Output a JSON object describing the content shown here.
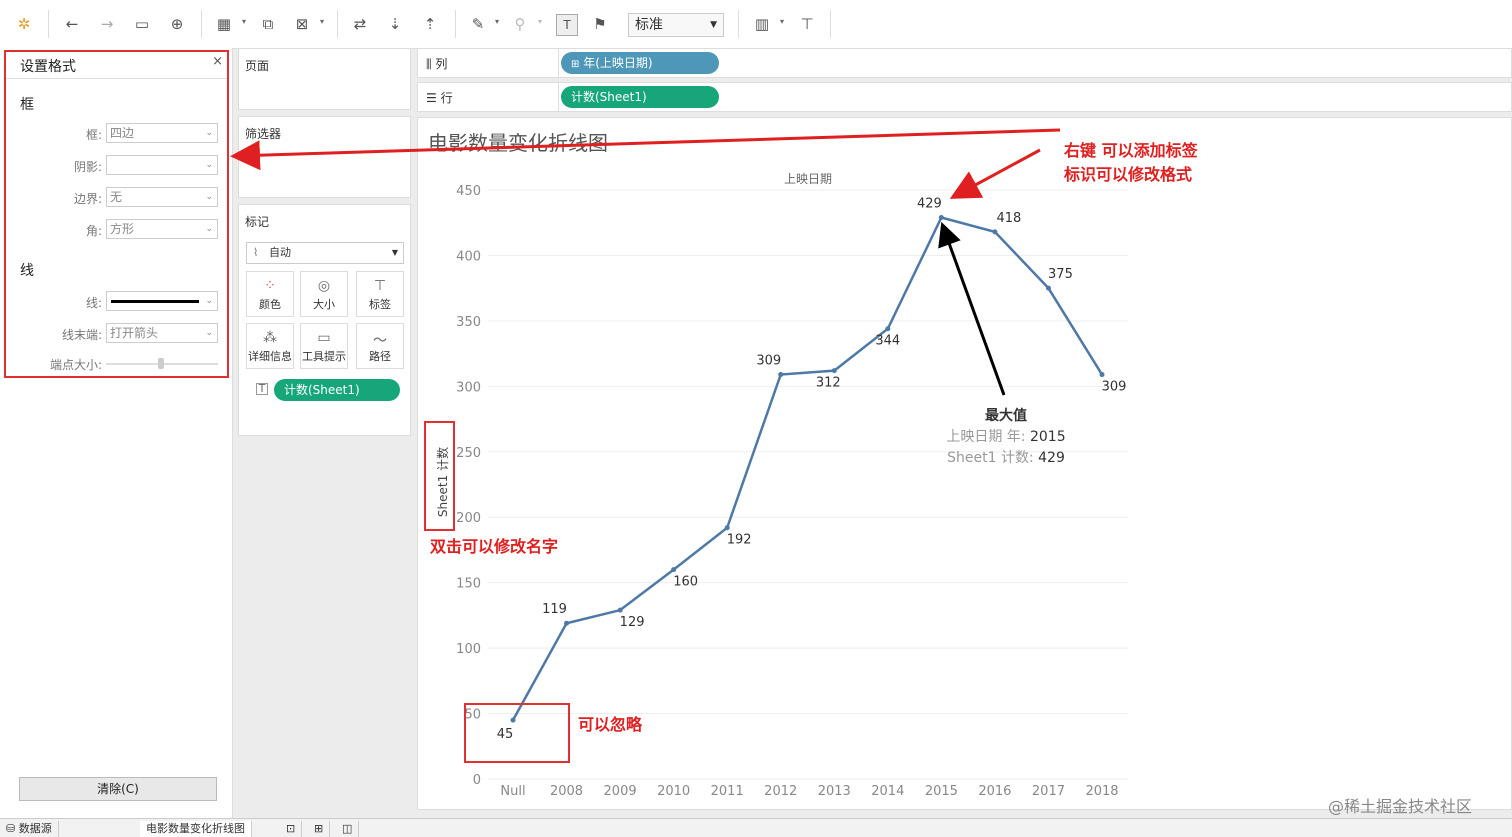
{
  "toolbar": {
    "view_select": "标准",
    "icons": [
      "tableau-logo-icon",
      "undo-icon",
      "redo-icon",
      "save-icon",
      "new-datasource-icon",
      "new-worksheet-icon",
      "duplicate-icon",
      "clear-sheet-icon",
      "swap-icon",
      "sort-asc-icon",
      "sort-desc-icon",
      "highlight-icon",
      "group-icon",
      "label-icon",
      "pin-icon",
      "show-me-icon",
      "presentation-icon"
    ]
  },
  "format_pane": {
    "title": "设置格式",
    "close": "×",
    "section_box": "框",
    "box_label": "框:",
    "box_value": "四边",
    "shadow_label": "阴影:",
    "shadow_value": "",
    "border_label": "边界:",
    "border_value": "无",
    "corner_label": "角:",
    "corner_value": "方形",
    "section_line": "线",
    "line_label": "线:",
    "line_end_label": "线末端:",
    "line_end_value": "打开箭头",
    "endpoint_label": "端点大小:",
    "clear_button": "清除(C)"
  },
  "pages_panel": {
    "title": "页面"
  },
  "filters_panel": {
    "title": "筛选器"
  },
  "marks_panel": {
    "title": "标记",
    "mark_type": "自动",
    "cards": [
      "颜色",
      "大小",
      "标签",
      "详细信息",
      "工具提示",
      "路径"
    ],
    "pill": "计数(Sheet1)"
  },
  "columns_shelf": {
    "label": "列",
    "pill": "年(上映日期)"
  },
  "rows_shelf": {
    "label": "行",
    "pill": "计数(Sheet1)"
  },
  "chart_data": {
    "type": "line",
    "title": "电影数量变化折线图",
    "xlabel": "上映日期",
    "ylabel": "Sheet1 计数",
    "categories": [
      "Null",
      "2008",
      "2009",
      "2010",
      "2011",
      "2012",
      "2013",
      "2014",
      "2015",
      "2016",
      "2017",
      "2018"
    ],
    "values": [
      45,
      119,
      129,
      160,
      192,
      309,
      312,
      344,
      429,
      418,
      375,
      309
    ],
    "y_ticks": [
      "0",
      "50",
      "100",
      "150",
      "200",
      "250",
      "300",
      "350",
      "400",
      "450"
    ],
    "ylim": [
      0,
      450
    ],
    "grid": "horizontal",
    "color": "#4e79a7",
    "annotation": {
      "title": "最大值",
      "line1_label": "上映日期 年:",
      "line1_value": "2015",
      "line2_label": "Sheet1 计数:",
      "line2_value": "429"
    }
  },
  "notes": {
    "right_click": "右键 可以添加标签",
    "right_click_2": "标识可以修改格式",
    "double_click": "双击可以修改名字",
    "ignore": "可以忽略"
  },
  "bottom_bar": {
    "datasource_tab": "数据源",
    "sheet_tab": "电影数量变化折线图"
  },
  "watermark": "@稀土掘金技术社区"
}
